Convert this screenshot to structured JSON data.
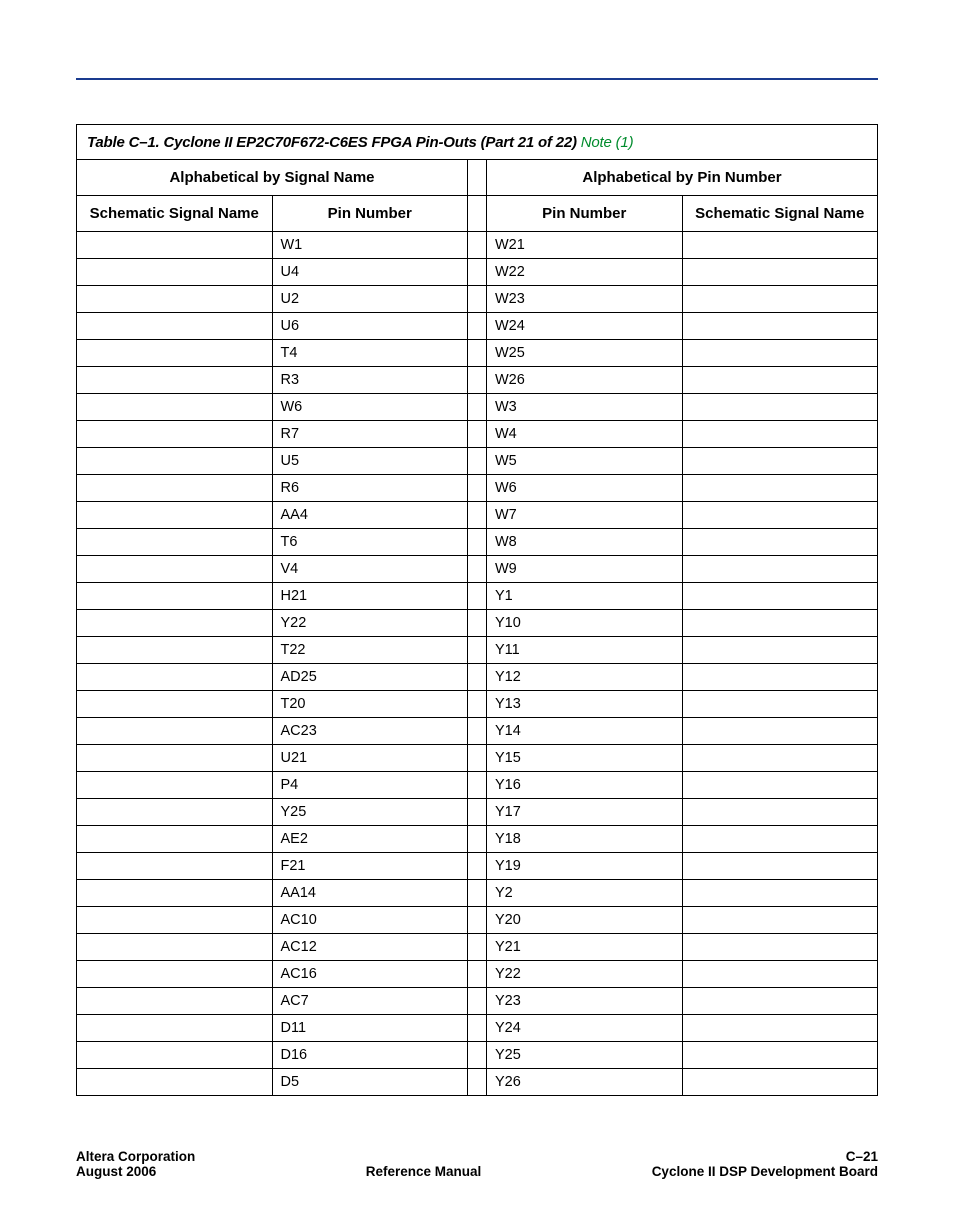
{
  "caption": {
    "main": "Table C–1. Cyclone II EP2C70F672-C6ES FPGA Pin-Outs  (Part 21 of 22) ",
    "note": "Note (1)"
  },
  "headers": {
    "left_group": "Alphabetical by Signal Name",
    "right_group": "Alphabetical by Pin Number",
    "schematic": "Schematic Signal Name",
    "pin": "Pin Number"
  },
  "rows": [
    {
      "l_sn": "",
      "l_pn": "W1",
      "r_pn": "W21",
      "r_sn": ""
    },
    {
      "l_sn": "",
      "l_pn": "U4",
      "r_pn": "W22",
      "r_sn": ""
    },
    {
      "l_sn": "",
      "l_pn": "U2",
      "r_pn": "W23",
      "r_sn": ""
    },
    {
      "l_sn": "",
      "l_pn": "U6",
      "r_pn": "W24",
      "r_sn": ""
    },
    {
      "l_sn": "",
      "l_pn": "T4",
      "r_pn": "W25",
      "r_sn": ""
    },
    {
      "l_sn": "",
      "l_pn": "R3",
      "r_pn": "W26",
      "r_sn": ""
    },
    {
      "l_sn": "",
      "l_pn": "W6",
      "r_pn": "W3",
      "r_sn": ""
    },
    {
      "l_sn": "",
      "l_pn": "R7",
      "r_pn": "W4",
      "r_sn": ""
    },
    {
      "l_sn": "",
      "l_pn": "U5",
      "r_pn": "W5",
      "r_sn": ""
    },
    {
      "l_sn": "",
      "l_pn": "R6",
      "r_pn": "W6",
      "r_sn": ""
    },
    {
      "l_sn": "",
      "l_pn": "AA4",
      "r_pn": "W7",
      "r_sn": ""
    },
    {
      "l_sn": "",
      "l_pn": "T6",
      "r_pn": "W8",
      "r_sn": ""
    },
    {
      "l_sn": "",
      "l_pn": "V4",
      "r_pn": "W9",
      "r_sn": ""
    },
    {
      "l_sn": "",
      "l_pn": "H21",
      "r_pn": "Y1",
      "r_sn": ""
    },
    {
      "l_sn": "",
      "l_pn": "Y22",
      "r_pn": "Y10",
      "r_sn": ""
    },
    {
      "l_sn": "",
      "l_pn": "T22",
      "r_pn": "Y11",
      "r_sn": ""
    },
    {
      "l_sn": "",
      "l_pn": "AD25",
      "r_pn": "Y12",
      "r_sn": ""
    },
    {
      "l_sn": "",
      "l_pn": "T20",
      "r_pn": "Y13",
      "r_sn": ""
    },
    {
      "l_sn": "",
      "l_pn": "AC23",
      "r_pn": "Y14",
      "r_sn": ""
    },
    {
      "l_sn": "",
      "l_pn": "U21",
      "r_pn": "Y15",
      "r_sn": ""
    },
    {
      "l_sn": "",
      "l_pn": "P4",
      "r_pn": "Y16",
      "r_sn": ""
    },
    {
      "l_sn": "",
      "l_pn": "Y25",
      "r_pn": "Y17",
      "r_sn": ""
    },
    {
      "l_sn": "",
      "l_pn": "AE2",
      "r_pn": "Y18",
      "r_sn": ""
    },
    {
      "l_sn": "",
      "l_pn": "F21",
      "r_pn": "Y19",
      "r_sn": ""
    },
    {
      "l_sn": "",
      "l_pn": "AA14",
      "r_pn": "Y2",
      "r_sn": ""
    },
    {
      "l_sn": "",
      "l_pn": "AC10",
      "r_pn": "Y20",
      "r_sn": ""
    },
    {
      "l_sn": "",
      "l_pn": "AC12",
      "r_pn": "Y21",
      "r_sn": ""
    },
    {
      "l_sn": "",
      "l_pn": "AC16",
      "r_pn": "Y22",
      "r_sn": ""
    },
    {
      "l_sn": "",
      "l_pn": "AC7",
      "r_pn": "Y23",
      "r_sn": ""
    },
    {
      "l_sn": "",
      "l_pn": "D11",
      "r_pn": "Y24",
      "r_sn": ""
    },
    {
      "l_sn": "",
      "l_pn": "D16",
      "r_pn": "Y25",
      "r_sn": ""
    },
    {
      "l_sn": "",
      "l_pn": "D5",
      "r_pn": "Y26",
      "r_sn": ""
    }
  ],
  "footer": {
    "left_top": "Altera Corporation",
    "left_bottom": "August 2006",
    "center": "Reference Manual",
    "right_top": "C–21",
    "right_bottom": "Cyclone II DSP Development Board"
  }
}
